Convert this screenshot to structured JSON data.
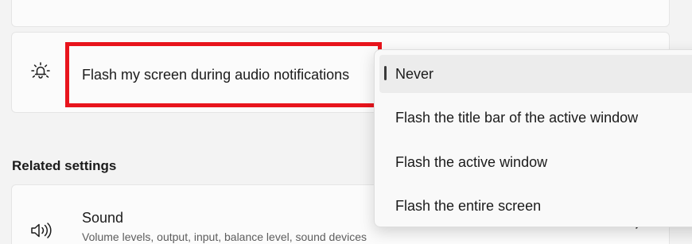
{
  "flash_setting": {
    "label": "Flash my screen during audio notifications",
    "icon": "bell-flash-icon"
  },
  "dropdown": {
    "options": [
      "Never",
      "Flash the title bar of the active window",
      "Flash the active window",
      "Flash the entire screen"
    ],
    "selected": "Never"
  },
  "related": {
    "heading": "Related settings",
    "sound": {
      "title": "Sound",
      "subtitle": "Volume levels, output, input, balance level, sound devices",
      "icon": "speaker-icon"
    }
  },
  "colors": {
    "highlight": "#e8141c",
    "background": "#f3f3f3",
    "card": "#fbfbfb"
  }
}
